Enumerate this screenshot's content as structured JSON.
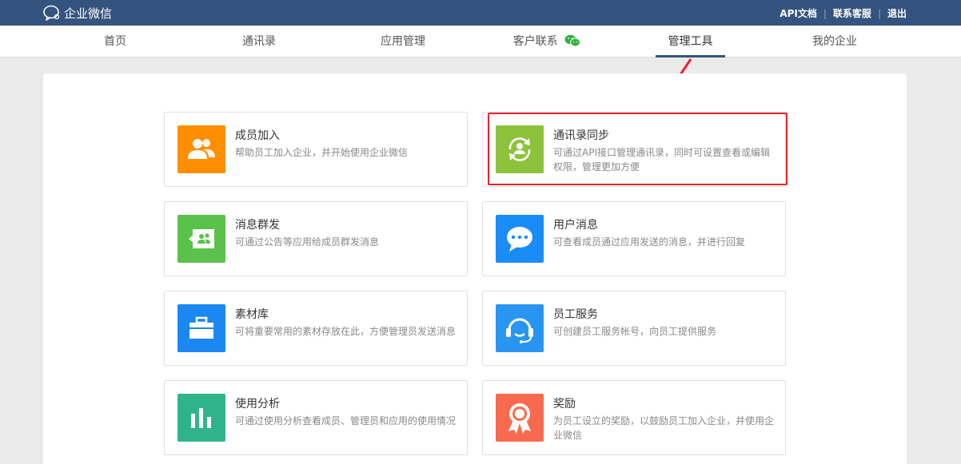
{
  "header": {
    "logo_text": "企业微信",
    "links": [
      "API文档",
      "联系客服",
      "退出"
    ]
  },
  "nav": {
    "tabs": [
      {
        "label": "首页"
      },
      {
        "label": "通讯录"
      },
      {
        "label": "应用管理"
      },
      {
        "label": "客户联系"
      },
      {
        "label": "管理工具"
      },
      {
        "label": "我的企业"
      }
    ],
    "active": "管理工具"
  },
  "tools": [
    {
      "title": "成员加入",
      "desc": "帮助员工加入企业，并开始使用企业微信",
      "icon": "members-join-icon",
      "color": "#ff8e00"
    },
    {
      "title": "通讯录同步",
      "desc": "可通过API接口管理通讯录，同时可设置查看或编辑权限，管理更加方便",
      "icon": "contacts-sync-icon",
      "color": "#8dc33c"
    },
    {
      "title": "消息群发",
      "desc": "可通过公告等应用给成员群发消息",
      "icon": "broadcast-message-icon",
      "color": "#5ac24a"
    },
    {
      "title": "用户消息",
      "desc": "可查看成员通过应用发送的消息，并进行回复",
      "icon": "chat-bubble-icon",
      "color": "#1a8cf6"
    },
    {
      "title": "素材库",
      "desc": "可将重要常用的素材存放在此，方便管理员发送消息",
      "icon": "briefcase-icon",
      "color": "#1a88f0"
    },
    {
      "title": "员工服务",
      "desc": "可创建员工服务帐号，向员工提供服务",
      "icon": "headset-icon",
      "color": "#2896f0"
    },
    {
      "title": "使用分析",
      "desc": "可通过使用分析查看成员、管理员和应用的使用情况",
      "icon": "bar-chart-icon",
      "color": "#2fb48a"
    },
    {
      "title": "奖励",
      "desc": "为员工设立的奖励，以鼓励员工加入企业，并使用企业微信",
      "icon": "award-icon",
      "color": "#f86a4f"
    }
  ],
  "colors": {
    "topbar": "#34537e",
    "highlight": "#e3242b"
  }
}
